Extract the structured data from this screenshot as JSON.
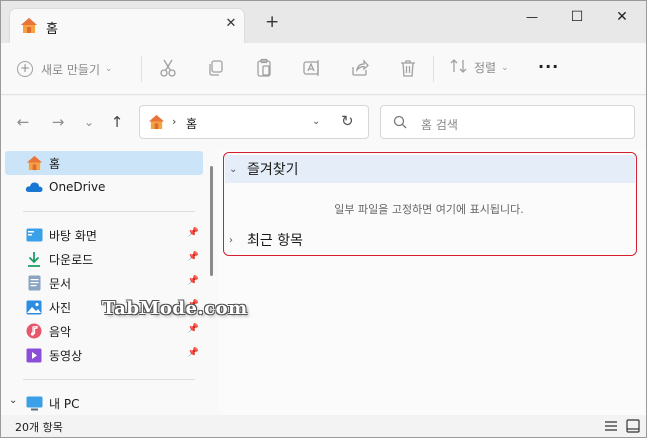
{
  "window": {
    "tab_title": "홈",
    "tab_close": "✕",
    "new_tab": "+",
    "controls": {
      "minimize": "—",
      "maximize": "☐",
      "close": "✕"
    }
  },
  "toolbar": {
    "new_label": "새로 만들기",
    "sort_label": "정렬",
    "more_label": "···",
    "icons": [
      "cut-icon",
      "copy-icon",
      "paste-icon",
      "rename-icon",
      "share-icon",
      "delete-icon"
    ]
  },
  "nav": {
    "back": "←",
    "forward": "→",
    "recent": "⌄",
    "up": "↑",
    "address_label": "홈",
    "address_sep": "›",
    "refresh": "↻",
    "search_placeholder": "홈 검색"
  },
  "sidebar": {
    "items": [
      {
        "label": "홈",
        "icon": "home-icon"
      },
      {
        "label": "OneDrive",
        "icon": "cloud-icon"
      },
      {
        "label": "바탕 화면",
        "icon": "desktop-icon",
        "pinned": true
      },
      {
        "label": "다운로드",
        "icon": "download-icon",
        "pinned": true
      },
      {
        "label": "문서",
        "icon": "document-icon",
        "pinned": true
      },
      {
        "label": "사진",
        "icon": "picture-icon",
        "pinned": true
      },
      {
        "label": "음악",
        "icon": "music-icon",
        "pinned": true
      },
      {
        "label": "동영상",
        "icon": "video-icon",
        "pinned": true
      },
      {
        "label": "내 PC",
        "icon": "pc-icon"
      }
    ]
  },
  "main": {
    "favorites_title": "즐겨찾기",
    "favorites_empty": "일부 파일을 고정하면 여기에 표시됩니다.",
    "recent_title": "최근 항목",
    "watermark": "TabMode.com"
  },
  "status": {
    "item_count": "20개 항목"
  },
  "colors": {
    "accent": "#0067c0",
    "selection": "#cce4f7",
    "highlight_box": "#d2202f"
  }
}
